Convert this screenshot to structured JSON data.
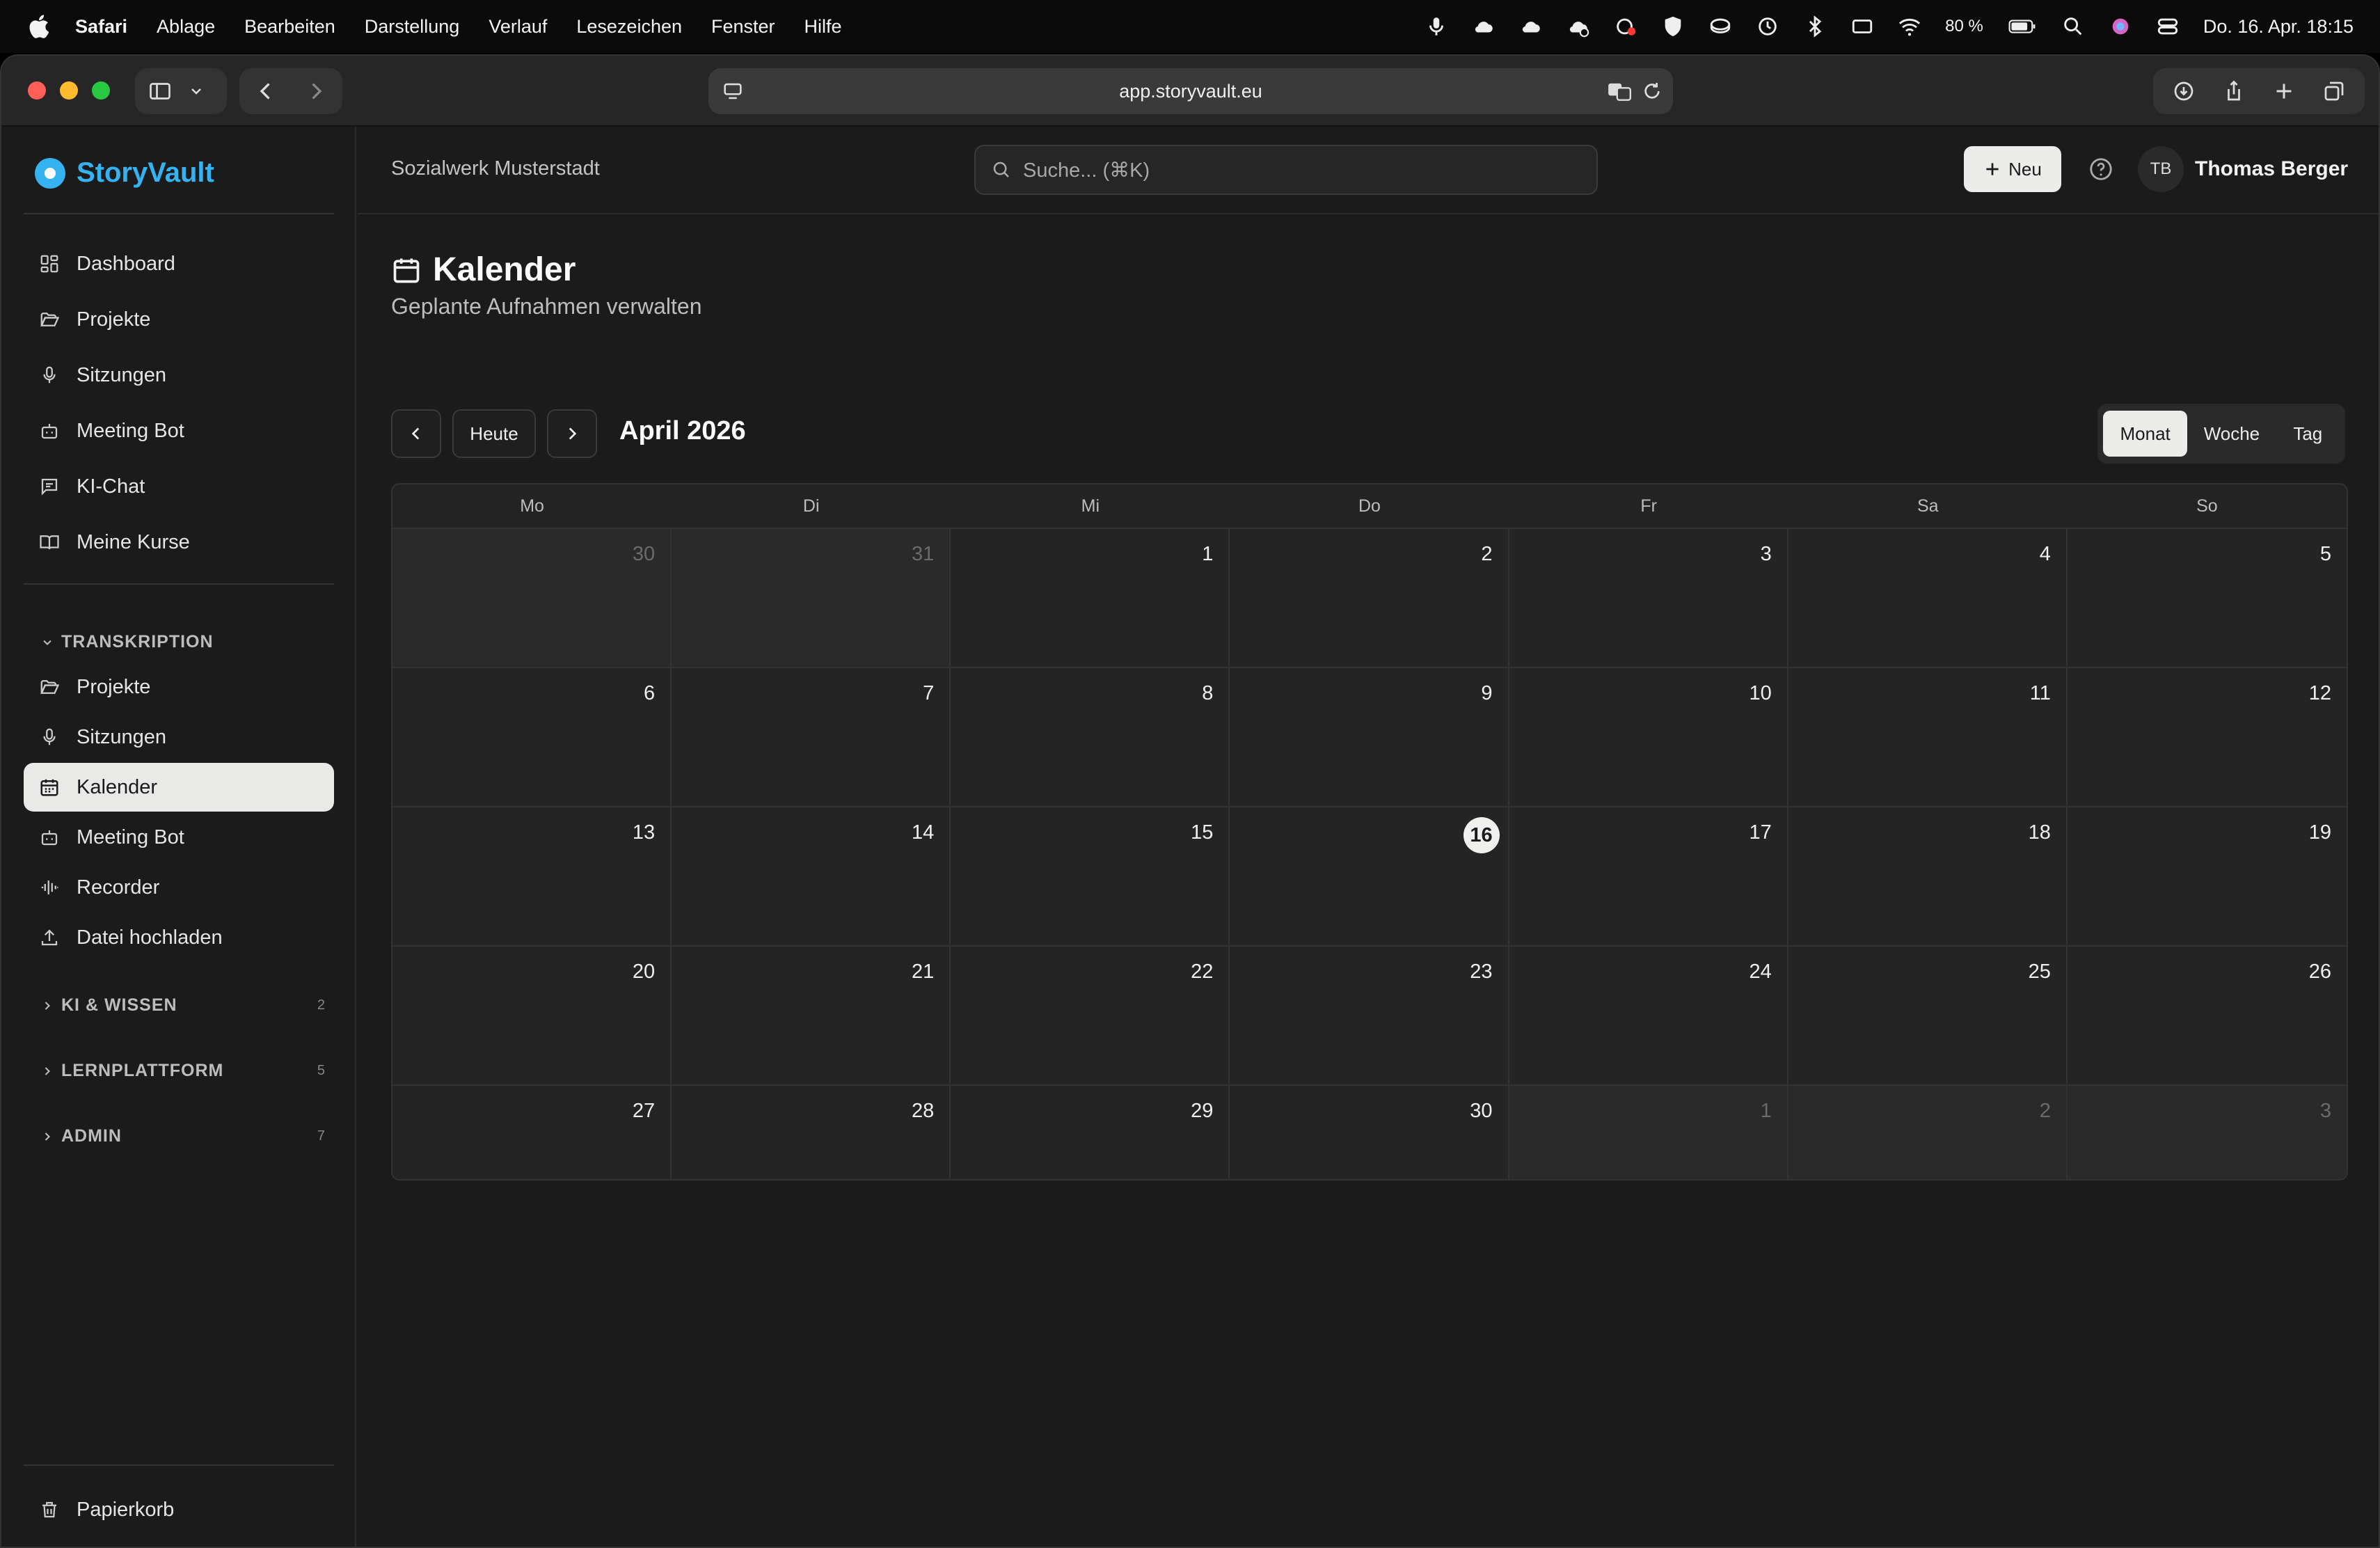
{
  "menubar": {
    "app": "Safari",
    "items": [
      "Ablage",
      "Bearbeiten",
      "Darstellung",
      "Verlauf",
      "Lesezeichen",
      "Fenster",
      "Hilfe"
    ],
    "battery": "80 %",
    "clock": "Do. 16. Apr.  18:15"
  },
  "browser": {
    "url": "app.storyvault.eu"
  },
  "app": {
    "brand": "StoryVault",
    "brand_color": "#35b3f0",
    "org": "Sozialwerk Musterstadt",
    "search_placeholder": "Suche... (⌘K)",
    "new_label": "Neu",
    "user_initials": "TB",
    "user_name": "Thomas Berger"
  },
  "sidebar": {
    "top_items": [
      "Dashboard",
      "Projekte",
      "Sitzungen",
      "Meeting Bot",
      "KI-Chat",
      "Meine Kurse"
    ],
    "section_transkription": "TRANSKRIPTION",
    "transkription_items": [
      "Projekte",
      "Sitzungen",
      "Kalender",
      "Meeting Bot",
      "Recorder",
      "Datei hochladen"
    ],
    "active_item": "Kalender",
    "sections": [
      {
        "label": "KI & WISSEN",
        "count": "2"
      },
      {
        "label": "LERNPLATTFORM",
        "count": "5"
      },
      {
        "label": "ADMIN",
        "count": "7"
      }
    ],
    "trash": "Papierkorb"
  },
  "page": {
    "title": "Kalender",
    "subtitle": "Geplante Aufnahmen verwalten",
    "today_button": "Heute",
    "month_label": "April 2026",
    "views": [
      "Monat",
      "Woche",
      "Tag"
    ],
    "active_view": "Monat"
  },
  "calendar": {
    "weekdays": [
      "Mo",
      "Di",
      "Mi",
      "Do",
      "Fr",
      "Sa",
      "So"
    ],
    "days": [
      {
        "n": "30",
        "out": true
      },
      {
        "n": "31",
        "out": true
      },
      {
        "n": "1"
      },
      {
        "n": "2"
      },
      {
        "n": "3"
      },
      {
        "n": "4"
      },
      {
        "n": "5"
      },
      {
        "n": "6"
      },
      {
        "n": "7"
      },
      {
        "n": "8"
      },
      {
        "n": "9"
      },
      {
        "n": "10"
      },
      {
        "n": "11"
      },
      {
        "n": "12"
      },
      {
        "n": "13"
      },
      {
        "n": "14"
      },
      {
        "n": "15"
      },
      {
        "n": "16",
        "today": true
      },
      {
        "n": "17"
      },
      {
        "n": "18"
      },
      {
        "n": "19"
      },
      {
        "n": "20"
      },
      {
        "n": "21"
      },
      {
        "n": "22"
      },
      {
        "n": "23"
      },
      {
        "n": "24"
      },
      {
        "n": "25"
      },
      {
        "n": "26"
      },
      {
        "n": "27"
      },
      {
        "n": "28"
      },
      {
        "n": "29"
      },
      {
        "n": "30"
      },
      {
        "n": "1",
        "out": true
      },
      {
        "n": "2",
        "out": true
      },
      {
        "n": "3",
        "out": true
      }
    ]
  }
}
